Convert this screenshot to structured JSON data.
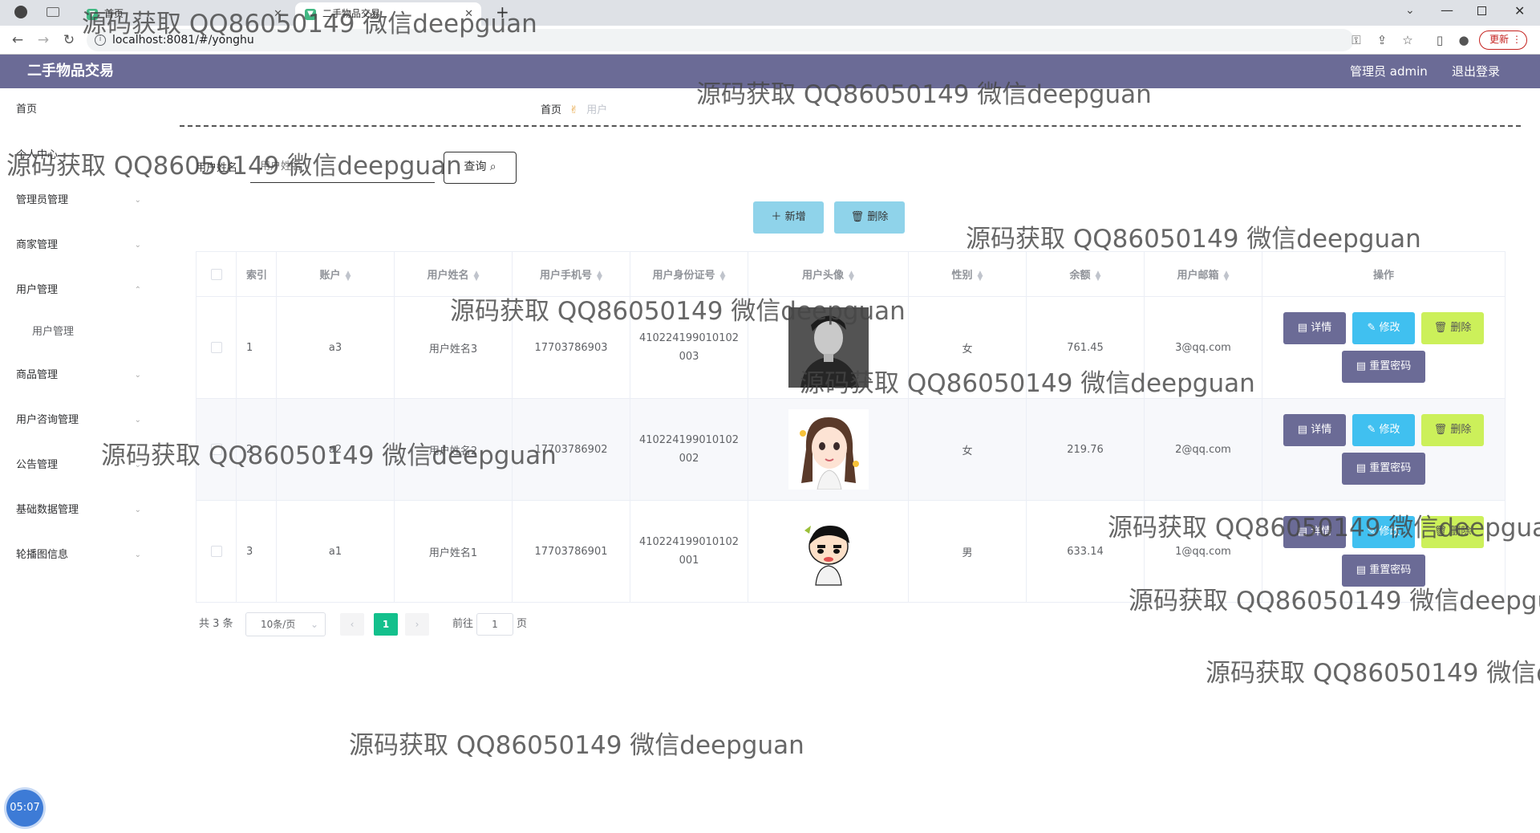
{
  "browser": {
    "tabs": [
      {
        "title": "首页",
        "icon": "vue-logo-icon"
      },
      {
        "title": "二手物品交易",
        "icon": "vue-logo-icon"
      }
    ],
    "url": "localhost:8081/#/yonghu",
    "update_label": "更新"
  },
  "header": {
    "app_title": "二手物品交易",
    "user_label": "管理员 admin",
    "logout_label": "退出登录"
  },
  "sidebar": {
    "items": [
      {
        "label": "首页",
        "has_arrow": false
      },
      {
        "label": "个人中心",
        "has_arrow": false
      },
      {
        "label": "管理员管理",
        "has_arrow": true
      },
      {
        "label": "商家管理",
        "has_arrow": true
      },
      {
        "label": "用户管理",
        "has_arrow": true,
        "expanded": true
      },
      {
        "label": "用户管理",
        "sub": true
      },
      {
        "label": "商品管理",
        "has_arrow": true
      },
      {
        "label": "用户咨询管理",
        "has_arrow": true
      },
      {
        "label": "公告管理",
        "has_arrow": true
      },
      {
        "label": "基础数据管理",
        "has_arrow": true
      },
      {
        "label": "轮播图信息",
        "has_arrow": true
      }
    ]
  },
  "breadcrumb": {
    "home": "首页",
    "current": "用户"
  },
  "search": {
    "label": "用户姓名",
    "placeholder": "用户姓名",
    "button_label": "查询"
  },
  "actions": {
    "add_label": "新增",
    "delete_label": "删除"
  },
  "table": {
    "columns": [
      "索引",
      "账户",
      "用户姓名",
      "用户手机号",
      "用户身份证号",
      "用户头像",
      "性别",
      "余额",
      "用户邮箱",
      "操作"
    ],
    "rows": [
      {
        "index": "1",
        "account": "a3",
        "name": "用户姓名3",
        "phone": "17703786903",
        "idcard_l1": "410224199010102",
        "idcard_l2": "003",
        "avatar": "photo-male",
        "gender": "女",
        "balance": "761.45",
        "email": "3@qq.com"
      },
      {
        "index": "2",
        "account": "a2",
        "name": "用户姓名2",
        "phone": "17703786902",
        "idcard_l1": "410224199010102",
        "idcard_l2": "002",
        "avatar": "cartoon-girl",
        "gender": "女",
        "balance": "219.76",
        "email": "2@qq.com"
      },
      {
        "index": "3",
        "account": "a1",
        "name": "用户姓名1",
        "phone": "17703786901",
        "idcard_l1": "410224199010102",
        "idcard_l2": "001",
        "avatar": "cartoon-boy",
        "gender": "男",
        "balance": "633.14",
        "email": "1@qq.com"
      }
    ],
    "ops": {
      "detail": "详情",
      "edit": "修改",
      "delete": "删除",
      "reset": "重置密码"
    }
  },
  "pagination": {
    "total_label": "共 3 条",
    "page_size": "10条/页",
    "current_page": "1",
    "goto_prefix": "前往",
    "goto_value": "1",
    "goto_suffix": "页"
  },
  "watermark": "源码获取 QQ86050149 微信deepguan",
  "clock": "05:07",
  "colors": {
    "header_bg": "#6b6b96",
    "add_btn": "#8fd3ea",
    "edit_btn": "#40c0f0",
    "delete_btn": "#ccf05a",
    "page_active": "#13c08c"
  }
}
